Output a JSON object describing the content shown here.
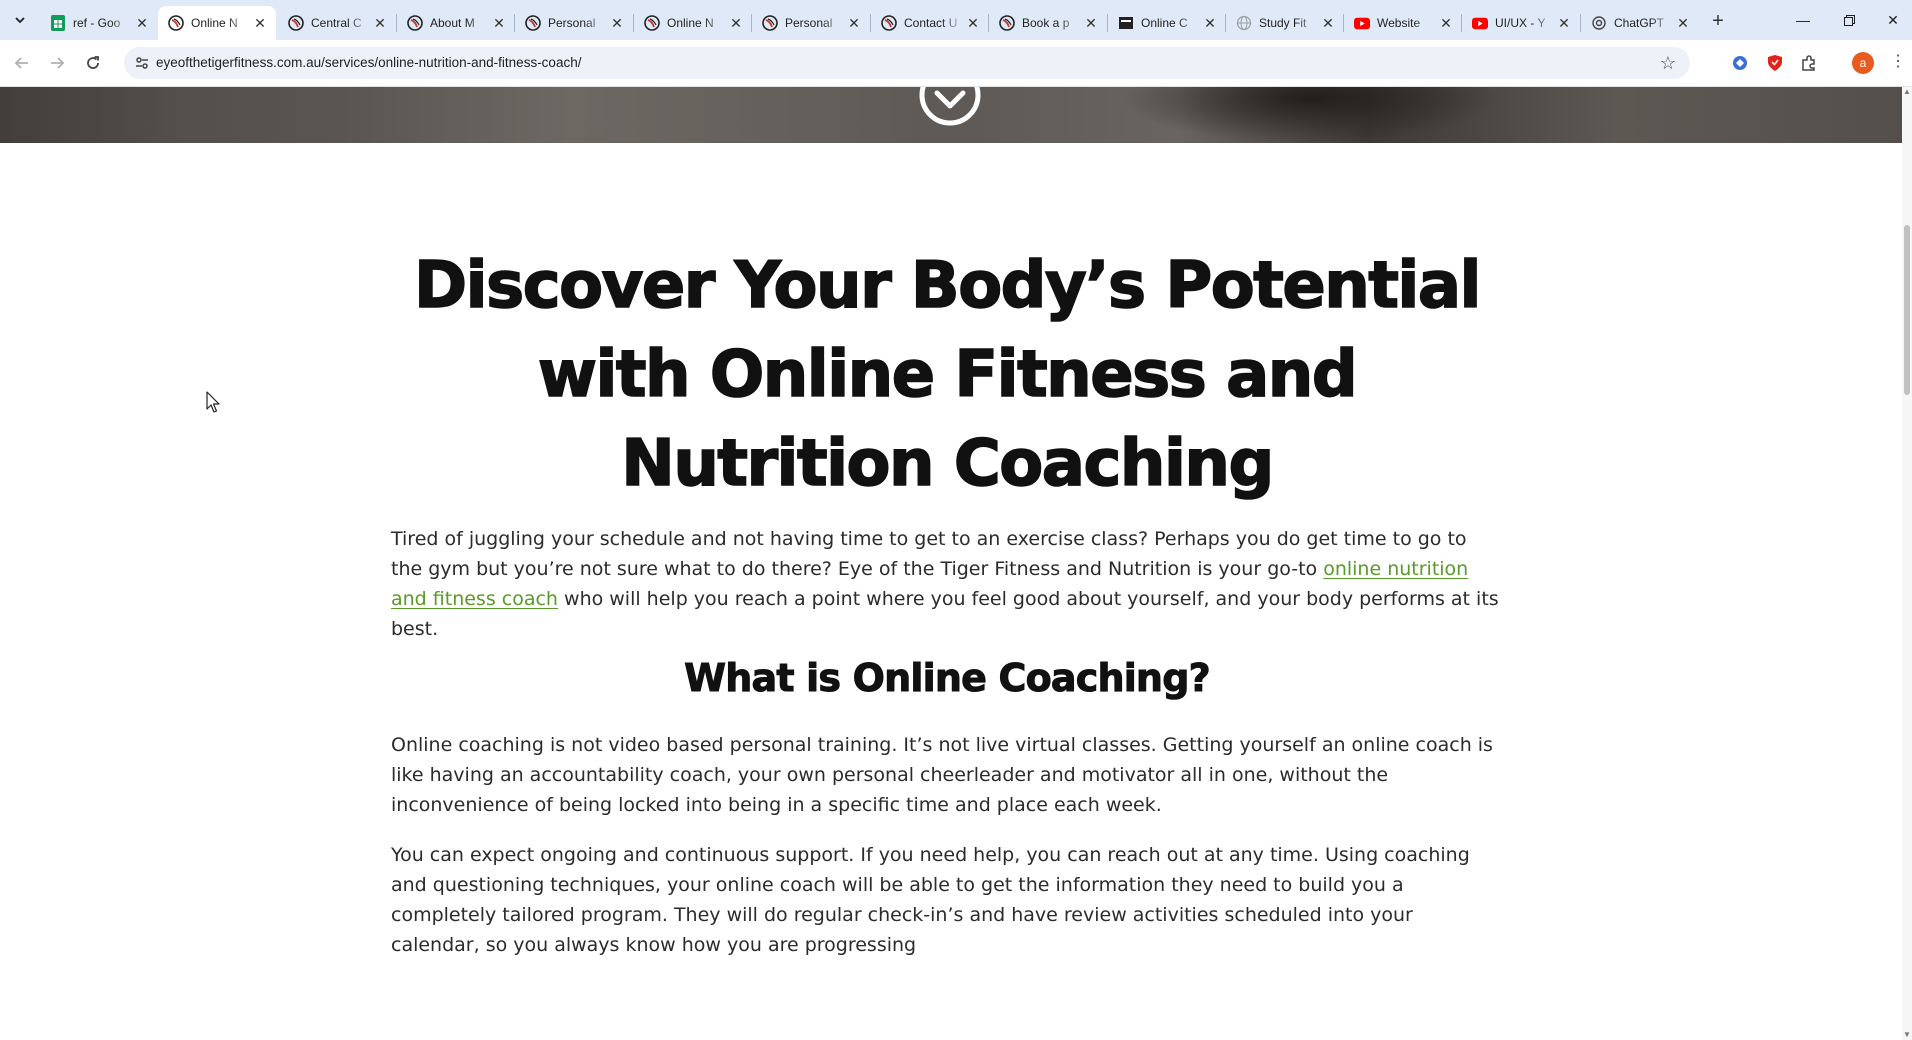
{
  "browser": {
    "tabs": [
      {
        "title": "ref - Goo",
        "favicon": "sheets-icon",
        "color": "#0f9d58"
      },
      {
        "title": "Online N",
        "favicon": "tiger-logo-icon",
        "color": "#c0392b",
        "active": true
      },
      {
        "title": "Central C",
        "favicon": "tiger-logo-icon",
        "color": "#c0392b"
      },
      {
        "title": "About M",
        "favicon": "tiger-logo-icon",
        "color": "#c0392b"
      },
      {
        "title": "Personal",
        "favicon": "tiger-logo-icon",
        "color": "#c0392b"
      },
      {
        "title": "Online N",
        "favicon": "tiger-logo-icon",
        "color": "#c0392b"
      },
      {
        "title": "Personal",
        "favicon": "tiger-logo-icon",
        "color": "#c0392b"
      },
      {
        "title": "Contact U",
        "favicon": "tiger-logo-icon",
        "color": "#c0392b"
      },
      {
        "title": "Book a p",
        "favicon": "tiger-logo-icon",
        "color": "#c0392b"
      },
      {
        "title": "Online C",
        "favicon": "site-logo-icon",
        "color": "#222222"
      },
      {
        "title": "Study Fit",
        "favicon": "globe-icon",
        "color": "#9aa0a6"
      },
      {
        "title": "Website",
        "favicon": "youtube-icon",
        "color": "#ff0000"
      },
      {
        "title": "UI/UX - Y",
        "favicon": "youtube-icon",
        "color": "#ff0000"
      },
      {
        "title": "ChatGPT",
        "favicon": "chatgpt-icon",
        "color": "#444444"
      }
    ],
    "url": "eyeofthetigerfitness.com.au/services/online-nutrition-and-fitness-coach/",
    "profile_initial": "a",
    "profile_color": "#e85a1e"
  },
  "page": {
    "heading": "Discover Your Body’s Potential with Online Fitness and Nutrition Coaching",
    "intro": {
      "before_link": "Tired of juggling your schedule and not having time to get to an exercise class? Perhaps you do get time to go to the gym but you’re not sure what to do there? Eye of the Tiger Fitness and Nutrition is your go-to ",
      "link_text": "online nutrition and fitness coach",
      "after_link": " who will help you reach a point where you feel good about yourself, and your body performs at its best."
    },
    "subheading": "What is Online Coaching?",
    "paragraph_2": "Online coaching is not video based personal training. It’s not live virtual classes. Getting yourself an online coach is like having an accountability coach, your own personal cheerleader and motivator all in one, without the inconvenience of being locked into being in a specific time and place each week.",
    "paragraph_3": "You can expect ongoing and continuous support. If you need help, you can reach out at any time. Using coaching and questioning techniques, your online coach will be able to get the information they need to build you a completely tailored program. They will do regular check-in’s and have review activities scheduled into your calendar, so you always know how you are progressing",
    "link_color": "#5a9a2a"
  }
}
